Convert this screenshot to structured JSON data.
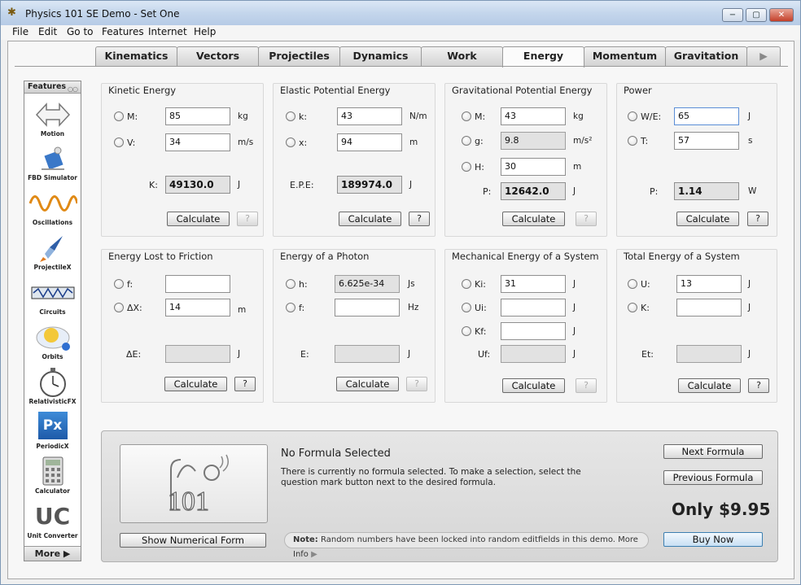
{
  "window": {
    "title": "Physics 101 SE Demo - Set One",
    "minimize": "−",
    "maximize": "▢",
    "close": "✕"
  },
  "menu": [
    "File",
    "Edit",
    "Go to",
    "Features",
    "Internet",
    "Help"
  ],
  "tabs": [
    "Kinematics",
    "Vectors",
    "Projectiles",
    "Dynamics",
    "Work",
    "Energy",
    "Momentum",
    "Gravitation"
  ],
  "tab_next": "▶",
  "active_tab": "Energy",
  "sidebar": {
    "header": "Features",
    "header_dots": "○○",
    "items": [
      "Motion",
      "FBD Simulator",
      "Oscillations",
      "ProjectileX",
      "Circuits",
      "Orbits",
      "RelativisticFX",
      "PeriodicX",
      "Calculator",
      "Unit Converter"
    ],
    "periodic_icon": "Px",
    "uc_icon": "UC",
    "more": "More ▶"
  },
  "panels": {
    "ke": {
      "title": "Kinetic Energy",
      "m_label": "M:",
      "m_value": "85",
      "m_unit": "kg",
      "v_label": "V:",
      "v_value": "34",
      "v_unit": "m/s",
      "res_label": "K:",
      "res_value": "49130.0",
      "res_unit": "J"
    },
    "epe": {
      "title": "Elastic Potential Energy",
      "k_label": "k:",
      "k_value": "43",
      "k_unit": "N/m",
      "x_label": "x:",
      "x_value": "94",
      "x_unit": "m",
      "res_label": "E.P.E:",
      "res_value": "189974.0",
      "res_unit": "J"
    },
    "gpe": {
      "title": "Gravitational Potential Energy",
      "m_label": "M:",
      "m_value": "43",
      "m_unit": "kg",
      "g_label": "g:",
      "g_value": "9.8",
      "g_unit": "m/s²",
      "h_label": "H:",
      "h_value": "30",
      "h_unit": "m",
      "res_label": "P:",
      "res_value": "12642.0",
      "res_unit": "J"
    },
    "power": {
      "title": "Power",
      "w_label": "W/E:",
      "w_value": "65",
      "w_unit": "J",
      "t_label": "T:",
      "t_value": "57",
      "t_unit": "s",
      "res_label": "P:",
      "res_value": "1.14",
      "res_unit": "W"
    },
    "friction": {
      "title": "Energy Lost to Friction",
      "f_label": "f:",
      "f_value": "",
      "f_unit": "",
      "x_label": "ΔX:",
      "x_value": "14",
      "x_unit": "m",
      "res_label": "ΔE:",
      "res_value": "",
      "res_unit": "J"
    },
    "photon": {
      "title": "Energy of a Photon",
      "h_label": "h:",
      "h_value": "6.625e-34",
      "h_unit": "Js",
      "f_label": "f:",
      "f_value": "",
      "f_unit": "Hz",
      "res_label": "E:",
      "res_value": "",
      "res_unit": "J"
    },
    "mech": {
      "title": "Mechanical Energy of a System",
      "ki_label": "Ki:",
      "ki_value": "31",
      "ki_unit": "J",
      "ui_label": "Ui:",
      "ui_value": "",
      "ui_unit": "J",
      "kf_label": "Kf:",
      "kf_value": "",
      "kf_unit": "J",
      "res_label": "Uf:",
      "res_value": "",
      "res_unit": "J"
    },
    "total": {
      "title": "Total Energy of a System",
      "u_label": "U:",
      "u_value": "13",
      "u_unit": "J",
      "k_label": "K:",
      "k_value": "",
      "k_unit": "J",
      "res_label": "Et:",
      "res_value": "",
      "res_unit": "J"
    }
  },
  "calculate": "Calculate",
  "help": "?",
  "bottom": {
    "formula_title": "No Formula Selected",
    "formula_desc": "There is currently no formula selected. To make a selection, select the question mark button next to the desired formula.",
    "show_numerical": "Show Numerical Form",
    "next_formula": "Next Formula",
    "prev_formula": "Previous Formula",
    "price": "Only $9.95",
    "buy_now": "Buy Now",
    "note_label": "Note:",
    "note_text": "Random numbers have been locked into random editfields in this demo. More Info",
    "note_arrow": "▶"
  }
}
